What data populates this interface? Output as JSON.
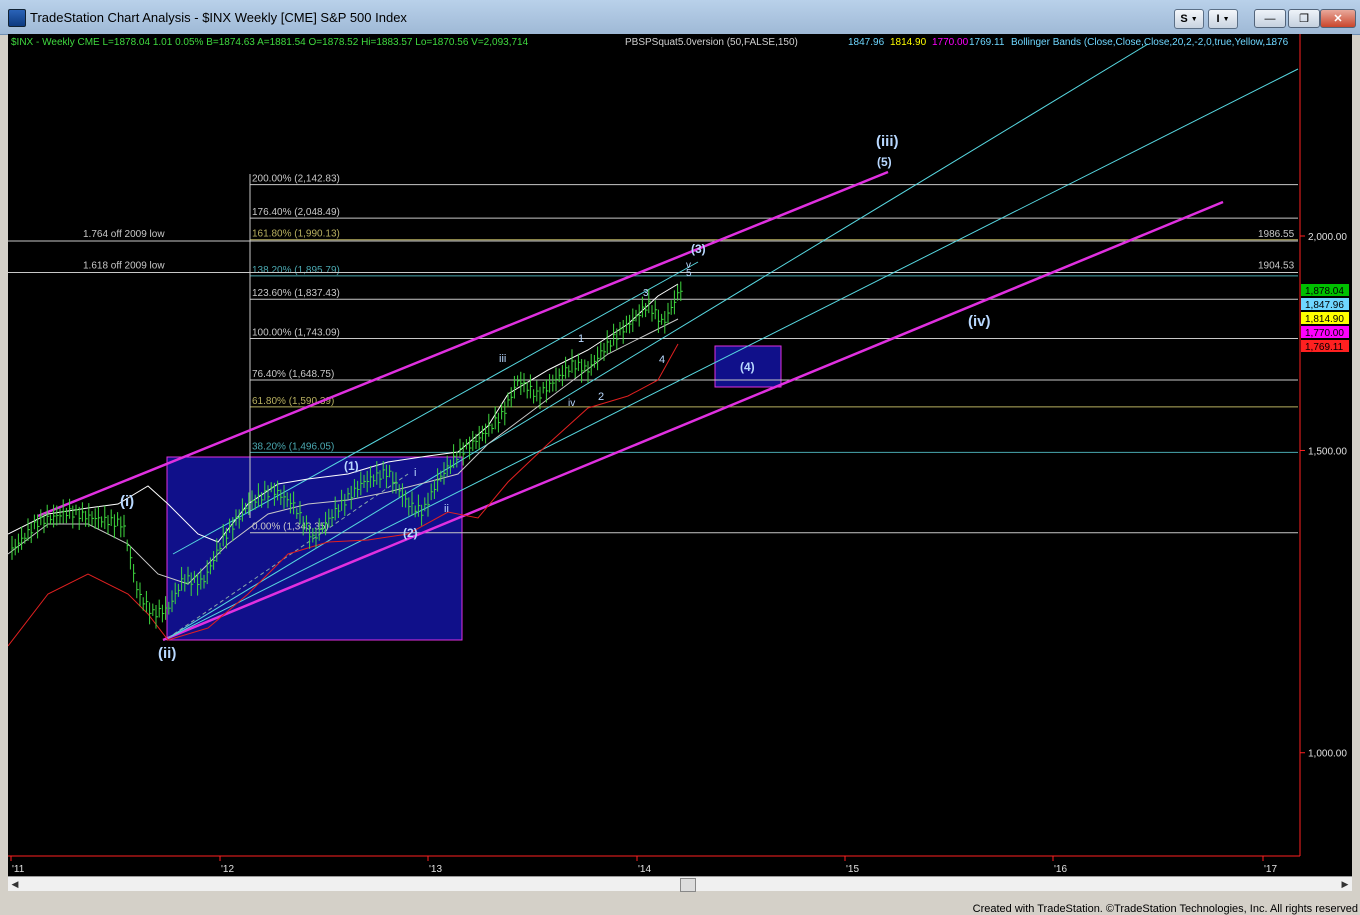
{
  "window": {
    "title": "TradeStation Chart Analysis - $INX Weekly [CME] S&P 500 Index",
    "btn_s": "S",
    "btn_i": "I",
    "minimize": "—",
    "maximize": "❐",
    "close": "✕"
  },
  "header": {
    "symbol_info": "$INX - Weekly  CME  L=1878.04  1.01  0.05%  B=1874.63  A=1881.54  O=1878.52  Hi=1883.57  Lo=1870.56  V=2,093,714",
    "indicator_name": "PBSPSquat5.0version (50,FALSE,150)",
    "ind_v1": "1847.96",
    "ind_v2": "1814.90",
    "ind_v3": "1770.00",
    "ind_v4": "1769.11",
    "bb_label": "Bollinger Bands (Close,Close,Close,20,2,-2,0,true,Yellow,...",
    "bb_value": "1876"
  },
  "colors": {
    "price_bar": "#3fd93f",
    "fib": "#c8c8c8",
    "channel": "#e030e0",
    "cyan": "#57d7e0",
    "red_band": "#e02020",
    "box_fill": "#10108a"
  },
  "fib_labels": [
    {
      "text": "200.00% (2,142.83)",
      "price": 2142.83
    },
    {
      "text": "176.40% (2,048.49)",
      "price": 2048.49
    },
    {
      "text": "161.80% (1,990.13)",
      "price": 1990.13
    },
    {
      "text": "138.20% (1,895.79)",
      "price": 1895.79
    },
    {
      "text": "123.60% (1,837.43)",
      "price": 1837.43
    },
    {
      "text": "100.00% (1,743.09)",
      "price": 1743.09
    },
    {
      "text": "76.40% (1,648.75)",
      "price": 1648.75
    },
    {
      "text": "61.80% (1,590.39)",
      "price": 1590.39
    },
    {
      "text": "38.20% (1,496.05)",
      "price": 1496.05
    },
    {
      "text": "0.00% (1,343.35)",
      "price": 1343.35
    }
  ],
  "off_lows": [
    {
      "text": "1.764 off 2009 low",
      "value": "1986.55",
      "price": 1986.55
    },
    {
      "text": "1.618 off 2009 low",
      "value": "1904.53",
      "price": 1904.53
    }
  ],
  "wave_labels": [
    "(iii)",
    "(5)",
    "(3)",
    "v",
    "5",
    "(iv)",
    "(4)",
    "iii",
    "1",
    "iv",
    "2",
    "3",
    "4",
    "(1)",
    "i",
    "ii",
    "(2)",
    "(i)",
    "(ii)"
  ],
  "price_axis": {
    "ticks": [
      "2,000.00",
      "1,500.00",
      "1,000.00"
    ],
    "badges": [
      {
        "text": "1,878.04",
        "bg": "#00c000",
        "fg": "#000"
      },
      {
        "text": "1,847.96",
        "bg": "#6fd7ff",
        "fg": "#000"
      },
      {
        "text": "1,814.90",
        "bg": "#ffff00",
        "fg": "#000"
      },
      {
        "text": "1,770.00",
        "bg": "#ff00ff",
        "fg": "#000"
      },
      {
        "text": "1,769.11",
        "bg": "#ff2020",
        "fg": "#000"
      }
    ]
  },
  "time_axis": [
    "'11",
    "'12",
    "'13",
    "'14",
    "'15",
    "'16",
    "'17"
  ],
  "footer": "Created with TradeStation. ©TradeStation Technologies, Inc. All rights reserved"
}
